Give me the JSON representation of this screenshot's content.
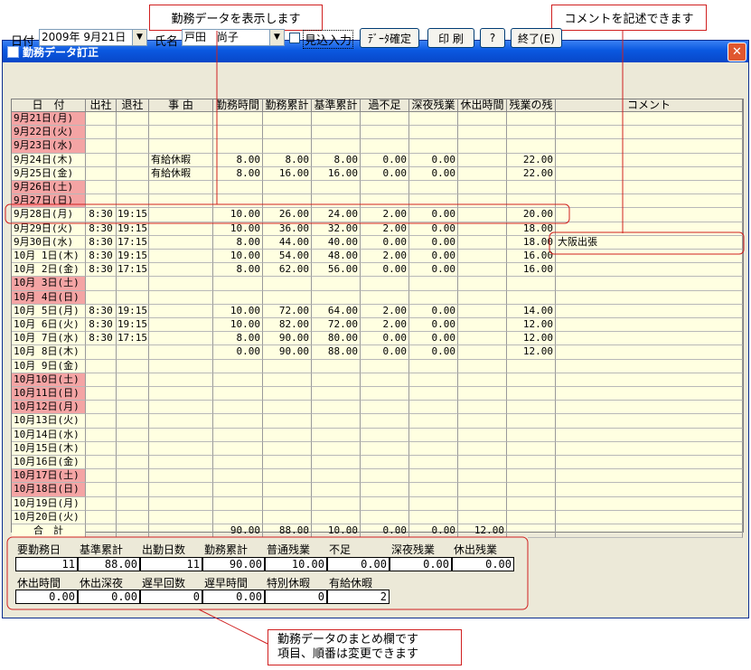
{
  "callouts": {
    "top_left": "勤務データを表示します",
    "top_right": "コメントを記述できます",
    "bottom_line1": "勤務データのまとめ欄です",
    "bottom_line2": "項目、順番は変更できます"
  },
  "window": {
    "title": "勤務データ訂正",
    "close": "✕"
  },
  "toolbar": {
    "date_label": "日付",
    "date_value": "2009年 9月21日",
    "name_label": "氏名",
    "last_name": "戸田",
    "first_name": "尚子",
    "mikomi_label": "見込入力",
    "confirm_label": "ﾃﾞｰﾀ確定",
    "print_label": "印 刷",
    "help_label": "?",
    "exit_label": "終了(E)"
  },
  "grid": {
    "headers": [
      "日　付",
      "出社",
      "退社",
      "事 由",
      "勤務時間",
      "勤務累計",
      "基準累計",
      "過不足",
      "深夜残業",
      "休出時間",
      "残業の残",
      "コメント"
    ],
    "rows": [
      {
        "date": "9月21日(月)",
        "holiday": true,
        "in": "",
        "out": "",
        "reason": "",
        "work": "",
        "cum": "",
        "base": "",
        "diff": "",
        "late": "",
        "hol": "",
        "rem": "",
        "comment": ""
      },
      {
        "date": "9月22日(火)",
        "holiday": true,
        "in": "",
        "out": "",
        "reason": "",
        "work": "",
        "cum": "",
        "base": "",
        "diff": "",
        "late": "",
        "hol": "",
        "rem": "",
        "comment": ""
      },
      {
        "date": "9月23日(水)",
        "holiday": true,
        "in": "",
        "out": "",
        "reason": "",
        "work": "",
        "cum": "",
        "base": "",
        "diff": "",
        "late": "",
        "hol": "",
        "rem": "",
        "comment": ""
      },
      {
        "date": "9月24日(木)",
        "holiday": false,
        "in": "",
        "out": "",
        "reason": "有給休暇",
        "work": "8.00",
        "cum": "8.00",
        "base": "8.00",
        "diff": "0.00",
        "late": "0.00",
        "hol": "",
        "rem": "22.00",
        "comment": ""
      },
      {
        "date": "9月25日(金)",
        "holiday": false,
        "in": "",
        "out": "",
        "reason": "有給休暇",
        "work": "8.00",
        "cum": "16.00",
        "base": "16.00",
        "diff": "0.00",
        "late": "0.00",
        "hol": "",
        "rem": "22.00",
        "comment": ""
      },
      {
        "date": "9月26日(土)",
        "holiday": true,
        "in": "",
        "out": "",
        "reason": "",
        "work": "",
        "cum": "",
        "base": "",
        "diff": "",
        "late": "",
        "hol": "",
        "rem": "",
        "comment": ""
      },
      {
        "date": "9月27日(日)",
        "holiday": true,
        "in": "",
        "out": "",
        "reason": "",
        "work": "",
        "cum": "",
        "base": "",
        "diff": "",
        "late": "",
        "hol": "",
        "rem": "",
        "comment": ""
      },
      {
        "date": "9月28日(月)",
        "holiday": false,
        "in": "8:30",
        "out": "19:15",
        "reason": "",
        "work": "10.00",
        "cum": "26.00",
        "base": "24.00",
        "diff": "2.00",
        "late": "0.00",
        "hol": "",
        "rem": "20.00",
        "comment": ""
      },
      {
        "date": "9月29日(火)",
        "holiday": false,
        "in": "8:30",
        "out": "19:15",
        "reason": "",
        "work": "10.00",
        "cum": "36.00",
        "base": "32.00",
        "diff": "2.00",
        "late": "0.00",
        "hol": "",
        "rem": "18.00",
        "comment": ""
      },
      {
        "date": "9月30日(水)",
        "holiday": false,
        "in": "8:30",
        "out": "17:15",
        "reason": "",
        "work": "8.00",
        "cum": "44.00",
        "base": "40.00",
        "diff": "0.00",
        "late": "0.00",
        "hol": "",
        "rem": "18.00",
        "comment": "大阪出張"
      },
      {
        "date": "10月 1日(木)",
        "holiday": false,
        "in": "8:30",
        "out": "19:15",
        "reason": "",
        "work": "10.00",
        "cum": "54.00",
        "base": "48.00",
        "diff": "2.00",
        "late": "0.00",
        "hol": "",
        "rem": "16.00",
        "comment": ""
      },
      {
        "date": "10月 2日(金)",
        "holiday": false,
        "in": "8:30",
        "out": "17:15",
        "reason": "",
        "work": "8.00",
        "cum": "62.00",
        "base": "56.00",
        "diff": "0.00",
        "late": "0.00",
        "hol": "",
        "rem": "16.00",
        "comment": ""
      },
      {
        "date": "10月 3日(土)",
        "holiday": true,
        "in": "",
        "out": "",
        "reason": "",
        "work": "",
        "cum": "",
        "base": "",
        "diff": "",
        "late": "",
        "hol": "",
        "rem": "",
        "comment": ""
      },
      {
        "date": "10月 4日(日)",
        "holiday": true,
        "in": "",
        "out": "",
        "reason": "",
        "work": "",
        "cum": "",
        "base": "",
        "diff": "",
        "late": "",
        "hol": "",
        "rem": "",
        "comment": ""
      },
      {
        "date": "10月 5日(月)",
        "holiday": false,
        "in": "8:30",
        "out": "19:15",
        "reason": "",
        "work": "10.00",
        "cum": "72.00",
        "base": "64.00",
        "diff": "2.00",
        "late": "0.00",
        "hol": "",
        "rem": "14.00",
        "comment": ""
      },
      {
        "date": "10月 6日(火)",
        "holiday": false,
        "in": "8:30",
        "out": "19:15",
        "reason": "",
        "work": "10.00",
        "cum": "82.00",
        "base": "72.00",
        "diff": "2.00",
        "late": "0.00",
        "hol": "",
        "rem": "12.00",
        "comment": ""
      },
      {
        "date": "10月 7日(水)",
        "holiday": false,
        "in": "8:30",
        "out": "17:15",
        "reason": "",
        "work": "8.00",
        "cum": "90.00",
        "base": "80.00",
        "diff": "0.00",
        "late": "0.00",
        "hol": "",
        "rem": "12.00",
        "comment": ""
      },
      {
        "date": "10月 8日(木)",
        "holiday": false,
        "in": "",
        "out": "",
        "reason": "",
        "work": "0.00",
        "cum": "90.00",
        "base": "88.00",
        "diff": "0.00",
        "late": "0.00",
        "hol": "",
        "rem": "12.00",
        "comment": ""
      },
      {
        "date": "10月 9日(金)",
        "holiday": false,
        "in": "",
        "out": "",
        "reason": "",
        "work": "",
        "cum": "",
        "base": "",
        "diff": "",
        "late": "",
        "hol": "",
        "rem": "",
        "comment": ""
      },
      {
        "date": "10月10日(土)",
        "holiday": true,
        "in": "",
        "out": "",
        "reason": "",
        "work": "",
        "cum": "",
        "base": "",
        "diff": "",
        "late": "",
        "hol": "",
        "rem": "",
        "comment": ""
      },
      {
        "date": "10月11日(日)",
        "holiday": true,
        "in": "",
        "out": "",
        "reason": "",
        "work": "",
        "cum": "",
        "base": "",
        "diff": "",
        "late": "",
        "hol": "",
        "rem": "",
        "comment": ""
      },
      {
        "date": "10月12日(月)",
        "holiday": true,
        "in": "",
        "out": "",
        "reason": "",
        "work": "",
        "cum": "",
        "base": "",
        "diff": "",
        "late": "",
        "hol": "",
        "rem": "",
        "comment": ""
      },
      {
        "date": "10月13日(火)",
        "holiday": false,
        "in": "",
        "out": "",
        "reason": "",
        "work": "",
        "cum": "",
        "base": "",
        "diff": "",
        "late": "",
        "hol": "",
        "rem": "",
        "comment": ""
      },
      {
        "date": "10月14日(水)",
        "holiday": false,
        "in": "",
        "out": "",
        "reason": "",
        "work": "",
        "cum": "",
        "base": "",
        "diff": "",
        "late": "",
        "hol": "",
        "rem": "",
        "comment": ""
      },
      {
        "date": "10月15日(木)",
        "holiday": false,
        "in": "",
        "out": "",
        "reason": "",
        "work": "",
        "cum": "",
        "base": "",
        "diff": "",
        "late": "",
        "hol": "",
        "rem": "",
        "comment": ""
      },
      {
        "date": "10月16日(金)",
        "holiday": false,
        "in": "",
        "out": "",
        "reason": "",
        "work": "",
        "cum": "",
        "base": "",
        "diff": "",
        "late": "",
        "hol": "",
        "rem": "",
        "comment": ""
      },
      {
        "date": "10月17日(土)",
        "holiday": true,
        "in": "",
        "out": "",
        "reason": "",
        "work": "",
        "cum": "",
        "base": "",
        "diff": "",
        "late": "",
        "hol": "",
        "rem": "",
        "comment": ""
      },
      {
        "date": "10月18日(日)",
        "holiday": true,
        "in": "",
        "out": "",
        "reason": "",
        "work": "",
        "cum": "",
        "base": "",
        "diff": "",
        "late": "",
        "hol": "",
        "rem": "",
        "comment": ""
      },
      {
        "date": "10月19日(月)",
        "holiday": false,
        "in": "",
        "out": "",
        "reason": "",
        "work": "",
        "cum": "",
        "base": "",
        "diff": "",
        "late": "",
        "hol": "",
        "rem": "",
        "comment": ""
      },
      {
        "date": "10月20日(火)",
        "holiday": false,
        "in": "",
        "out": "",
        "reason": "",
        "work": "",
        "cum": "",
        "base": "",
        "diff": "",
        "late": "",
        "hol": "",
        "rem": "",
        "comment": ""
      }
    ],
    "total": {
      "date": "合　計",
      "in": "",
      "out": "",
      "reason": "",
      "work": "90.00",
      "cum": "88.00",
      "base": "10.00",
      "diff": "0.00",
      "late": "0.00",
      "hol": "12.00",
      "rem": "",
      "comment": ""
    }
  },
  "summary": {
    "row1": [
      {
        "label": "要勤務日",
        "value": "11"
      },
      {
        "label": "基準累計",
        "value": "88.00"
      },
      {
        "label": "出勤日数",
        "value": "11"
      },
      {
        "label": "勤務累計",
        "value": "90.00"
      },
      {
        "label": "普通残業",
        "value": "10.00"
      },
      {
        "label": "不足",
        "value": "0.00"
      },
      {
        "label": "深夜残業",
        "value": "0.00"
      },
      {
        "label": "休出残業",
        "value": "0.00"
      }
    ],
    "row2": [
      {
        "label": "休出時間",
        "value": "0.00"
      },
      {
        "label": "休出深夜",
        "value": "0.00"
      },
      {
        "label": "遅早回数",
        "value": "0"
      },
      {
        "label": "遅早時間",
        "value": "0.00"
      },
      {
        "label": "特別休暇",
        "value": "0"
      },
      {
        "label": "有給休暇",
        "value": "2"
      }
    ]
  },
  "colors": {
    "holiday": "#f4a4a4",
    "cell": "#ffffe1",
    "accent": "#d02020"
  }
}
